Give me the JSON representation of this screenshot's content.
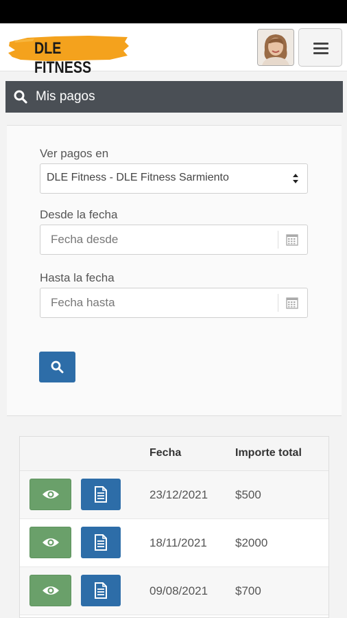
{
  "brand": {
    "logo_text": "DLE FITNESS"
  },
  "header": {
    "avatar_icon": "user-avatar",
    "menu_icon": "hamburger-icon"
  },
  "panel": {
    "title": "Mis pagos",
    "title_icon": "search-icon"
  },
  "filters": {
    "gym_label": "Ver pagos en",
    "gym_selected": "DLE Fitness - DLE Fitness Sarmiento",
    "from_label": "Desde la fecha",
    "from_placeholder": "Fecha desde",
    "to_label": "Hasta la fecha",
    "to_placeholder": "Fecha hasta",
    "search_button_icon": "search-icon"
  },
  "table": {
    "headers": {
      "actions": "",
      "date": "Fecha",
      "amount": "Importe total"
    },
    "rows": [
      {
        "date": "23/12/2021",
        "amount": "$500"
      },
      {
        "date": "18/11/2021",
        "amount": "$2000"
      },
      {
        "date": "09/08/2021",
        "amount": "$700"
      }
    ]
  },
  "colors": {
    "header_dark": "#4a4f55",
    "primary_blue": "#2d6da8",
    "success_green": "#6aa06a",
    "logo_orange": "#f4a21d"
  }
}
